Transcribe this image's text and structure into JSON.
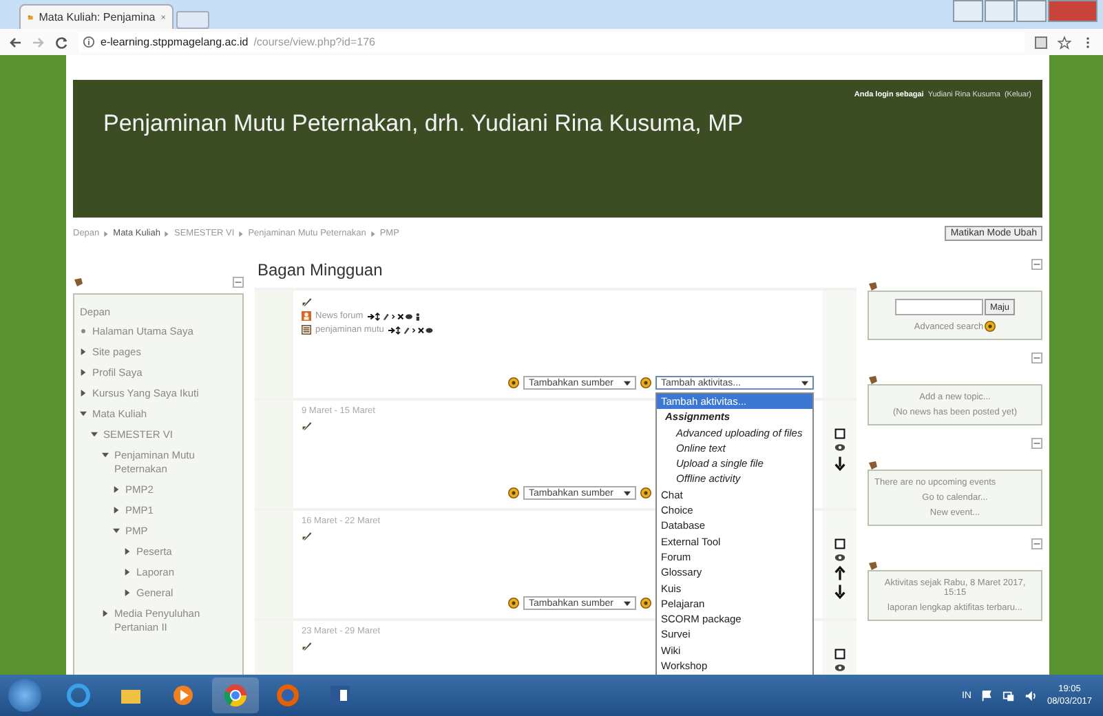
{
  "browser": {
    "tab_title": "Mata Kuliah: Penjamina",
    "address_host": "e-learning.stppmagelang.ac.id",
    "address_path": "/course/view.php?id=176"
  },
  "header": {
    "title": "Penjaminan Mutu Peternakan, drh. Yudiani Rina Kusuma, MP",
    "login_prefix": "Anda login sebagai",
    "user": "Yudiani Rina Kusuma",
    "logout": "(Keluar)"
  },
  "breadcrumb": [
    "Depan",
    "Mata Kuliah",
    "SEMESTER VI",
    "Penjaminan Mutu Peternakan",
    "PMP"
  ],
  "edit_button": "Matikan Mode Ubah",
  "navigation": {
    "root": "Depan",
    "items": [
      {
        "label": "Halaman Utama Saya"
      },
      {
        "label": "Site pages",
        "expanded": false
      },
      {
        "label": "Profil Saya",
        "expanded": false
      },
      {
        "label": "Kursus Yang Saya Ikuti",
        "expanded": false
      },
      {
        "label": "Mata Kuliah",
        "expanded": true,
        "children": [
          {
            "label": "SEMESTER VI",
            "expanded": true,
            "children": [
              {
                "label": "Penjaminan Mutu Peternakan",
                "expanded": true,
                "children": [
                  {
                    "label": "PMP2",
                    "expanded": false
                  },
                  {
                    "label": "PMP1",
                    "expanded": false
                  },
                  {
                    "label": "PMP",
                    "expanded": true,
                    "children": [
                      {
                        "label": "Peserta",
                        "expanded": false
                      },
                      {
                        "label": "Laporan",
                        "expanded": false
                      },
                      {
                        "label": "General",
                        "expanded": false
                      }
                    ]
                  }
                ]
              },
              {
                "label": "Media Penyuluhan Pertanian II",
                "expanded": false
              }
            ]
          }
        ]
      }
    ]
  },
  "main": {
    "title": "Bagan Mingguan",
    "sections": [
      {
        "items": [
          {
            "kind": "forum",
            "label": "News forum"
          },
          {
            "kind": "page",
            "label": "penjaminan mutu"
          }
        ],
        "resource_select": "Tambahkan sumber",
        "activity_select": {
          "label": "Tambah aktivitas...",
          "open": true
        },
        "side_controls": false
      },
      {
        "date": "9 Maret - 15 Maret",
        "resource_select": "Tambahkan sumber",
        "side_controls": true,
        "move_down": true
      },
      {
        "date": "16 Maret - 22 Maret",
        "resource_select": "Tambahkan sumber",
        "side_controls": true,
        "move_up": true,
        "move_down": true
      },
      {
        "date": "23 Maret - 29 Maret",
        "side_controls": true
      }
    ]
  },
  "activity_menu": [
    {
      "kind": "option",
      "label": "Tambah aktivitas...",
      "selected": true
    },
    {
      "kind": "group",
      "label": "Assignments",
      "selected": false,
      "children": [
        {
          "kind": "option",
          "label": "Advanced uploading of files",
          "selected": false
        },
        {
          "kind": "option",
          "label": "Online text",
          "selected": false
        },
        {
          "kind": "option",
          "label": "Upload a single file",
          "selected": false
        },
        {
          "kind": "option",
          "label": "Offline activity",
          "selected": false
        }
      ]
    },
    {
      "kind": "option",
      "label": "Chat",
      "selected": false
    },
    {
      "kind": "option",
      "label": "Choice",
      "selected": false
    },
    {
      "kind": "option",
      "label": "Database",
      "selected": false
    },
    {
      "kind": "option",
      "label": "External Tool",
      "selected": false
    },
    {
      "kind": "option",
      "label": "Forum",
      "selected": false
    },
    {
      "kind": "option",
      "label": "Glossary",
      "selected": false
    },
    {
      "kind": "option",
      "label": "Kuis",
      "selected": false
    },
    {
      "kind": "option",
      "label": "Pelajaran",
      "selected": false
    },
    {
      "kind": "option",
      "label": "SCORM package",
      "selected": false
    },
    {
      "kind": "option",
      "label": "Survei",
      "selected": false
    },
    {
      "kind": "option",
      "label": "Wiki",
      "selected": false
    },
    {
      "kind": "option",
      "label": "Workshop",
      "selected": false
    }
  ],
  "blocks": [
    {
      "kind": "search",
      "button": "Maju",
      "link": "Advanced search"
    },
    {
      "kind": "news",
      "link": "Add a new topic...",
      "note": "(No news has been posted yet)"
    },
    {
      "kind": "calendar",
      "note": "There are no upcoming events",
      "links": [
        "Go to calendar...",
        "New event..."
      ]
    },
    {
      "kind": "activity",
      "note": "Aktivitas sejak Rabu, 8 Maret 2017, 15:15",
      "link": "laporan lengkap aktifitas terbaru..."
    }
  ],
  "taskbar": {
    "language": "IN",
    "time": "19:05",
    "date": "08/03/2017"
  }
}
